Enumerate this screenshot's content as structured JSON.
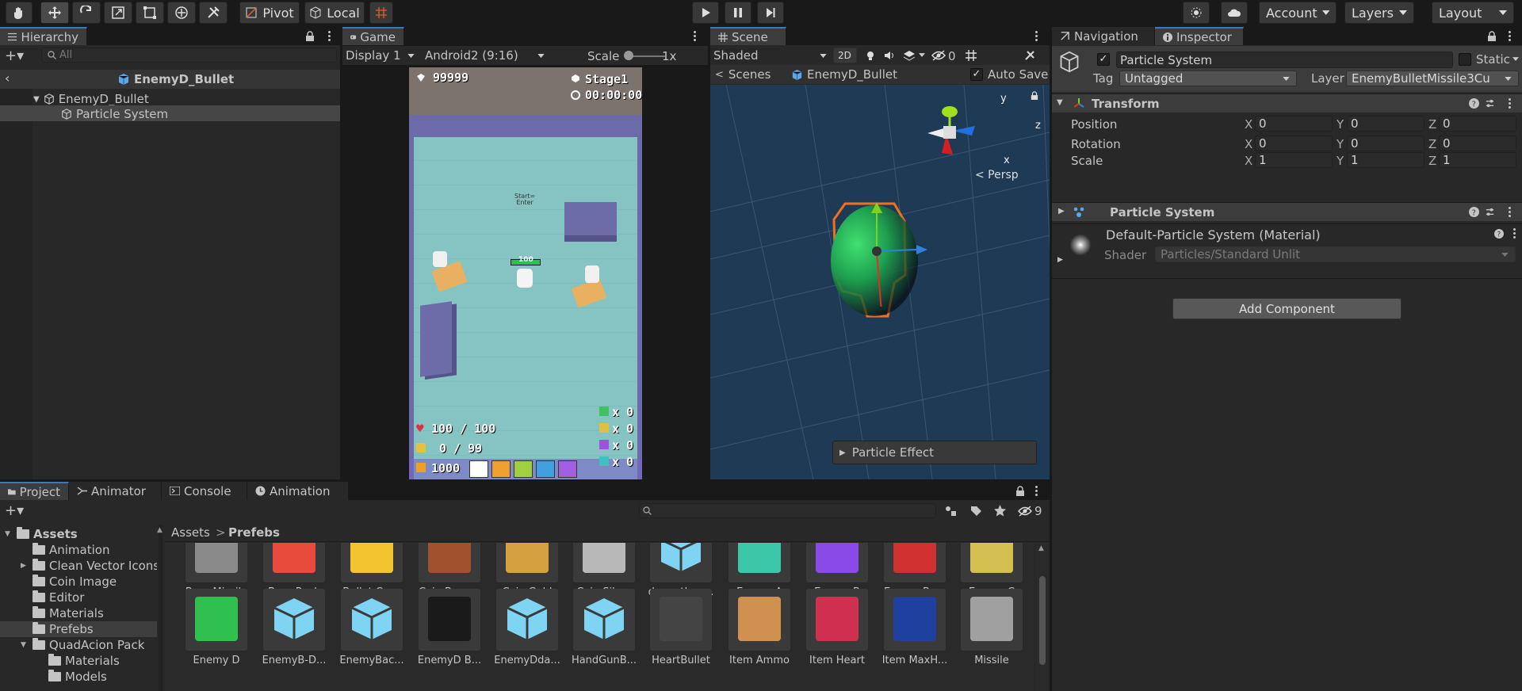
{
  "toolbar": {
    "pivot": "Pivot",
    "local": "Local",
    "account": "Account",
    "layers": "Layers",
    "layout": "Layout",
    "icons": [
      "hand-tool-icon",
      "move-tool-icon",
      "rotate-tool-icon",
      "scale-tool-icon",
      "rect-tool-icon",
      "transform-tool-icon",
      "custom-tool-icon",
      "grid-snap-icon",
      "play-icon",
      "pause-icon",
      "step-icon",
      "collab-icon",
      "cloud-icon"
    ]
  },
  "hierarchy": {
    "tab": "Hierarchy",
    "search_placeholder": "All",
    "scene_title": "EnemyD_Bullet",
    "items": [
      {
        "label": "EnemyD_Bullet"
      },
      {
        "label": "Particle System"
      }
    ]
  },
  "game": {
    "tab": "Game",
    "display": "Display 1",
    "aspect": "Android2 (9:16)",
    "scale_label": "Scale",
    "scale_value": "1x",
    "hud": {
      "score": "99999",
      "stage": "Stage1",
      "time": "00:00:00",
      "hp": "100 / 100",
      "ammo": "0 / 99",
      "coins": "1000",
      "counts": [
        "x 0",
        "x 0",
        "x 0",
        "x 0"
      ],
      "start_hint_1": "Start=",
      "start_hint_2": "Enter",
      "enemy_hp": "100"
    }
  },
  "scene": {
    "tab": "Scene",
    "shading": "Shaded",
    "mode_2d": "2D",
    "hidden_count": "0",
    "breadcrumb_root": "Scenes",
    "breadcrumb_item": "EnemyD_Bullet",
    "auto_save": "Auto Save",
    "auto_save_checked": true,
    "gizmo": {
      "y": "y",
      "z": "z",
      "x": "x",
      "persp": "< Persp"
    },
    "overlay": "Particle Effect"
  },
  "inspector": {
    "tabs": [
      "Navigation",
      "Inspector"
    ],
    "object_name": "Particle System",
    "static_label": "Static",
    "tag_label": "Tag",
    "tag_value": "Untagged",
    "layer_label": "Layer",
    "layer_value": "EnemyBulletMissile3Cu",
    "transform": {
      "title": "Transform",
      "rows": [
        {
          "label": "Position",
          "x": "0",
          "y": "0",
          "z": "0"
        },
        {
          "label": "Rotation",
          "x": "0",
          "y": "0",
          "z": "0"
        },
        {
          "label": "Scale",
          "x": "1",
          "y": "1",
          "z": "1"
        }
      ],
      "axis": [
        "X",
        "Y",
        "Z"
      ]
    },
    "particle_system": {
      "title": "Particle System"
    },
    "material": {
      "name": "Default-Particle System (Material)",
      "shader_label": "Shader",
      "shader_value": "Particles/Standard Unlit"
    },
    "add_component": "Add Component"
  },
  "project": {
    "tabs": [
      "Project",
      "Animator",
      "Console",
      "Animation"
    ],
    "hidden_count": "9",
    "breadcrumb": [
      "Assets",
      "Prefebs"
    ],
    "tree": [
      {
        "label": "Assets",
        "level": 0
      },
      {
        "label": "Animation",
        "level": 1
      },
      {
        "label": "Clean Vector Icons",
        "level": 1
      },
      {
        "label": "Coin Image",
        "level": 1
      },
      {
        "label": "Editor",
        "level": 1
      },
      {
        "label": "Materials",
        "level": 1
      },
      {
        "label": "Prefebs",
        "level": 1
      },
      {
        "label": "QuadAcion Pack",
        "level": 1
      },
      {
        "label": "Materials",
        "level": 2
      },
      {
        "label": "Models",
        "level": 2
      }
    ],
    "assets_row1": [
      "Boss Missile",
      "Boss Rock",
      "Bullet Case",
      "Coin Bronze",
      "Coin Gold",
      "Coin Silver",
      "dangetIma...",
      "Enemy A",
      "Enemy B",
      "Enemy Bo...",
      "Enemy C"
    ],
    "assets_row2": [
      "Enemy D",
      "EnemyB-D...",
      "EnemyBac...",
      "EnemyD B...",
      "EnemyDda...",
      "HandGunB...",
      "HeartBullet",
      "Item Ammo",
      "Item Heart",
      "Item MaxH...",
      "Missile"
    ],
    "tile_colors_row1": [
      "#8a8a8a",
      "#e84a3c",
      "#f4c430",
      "#a0522d",
      "#d4a040",
      "#b8b8b8",
      "#7fd4f4",
      "#3cc8a8",
      "#8a4ae8",
      "#d03030",
      "#d4c050"
    ],
    "tile_colors_row2": [
      "#30c050",
      "#7fd4f4",
      "#7fd4f4",
      "#1a1a1a",
      "#7fd4f4",
      "#7fd4f4",
      "#3a3a3a",
      "#d09050",
      "#d03050",
      "#2040a0",
      "#a0a0a0"
    ]
  }
}
